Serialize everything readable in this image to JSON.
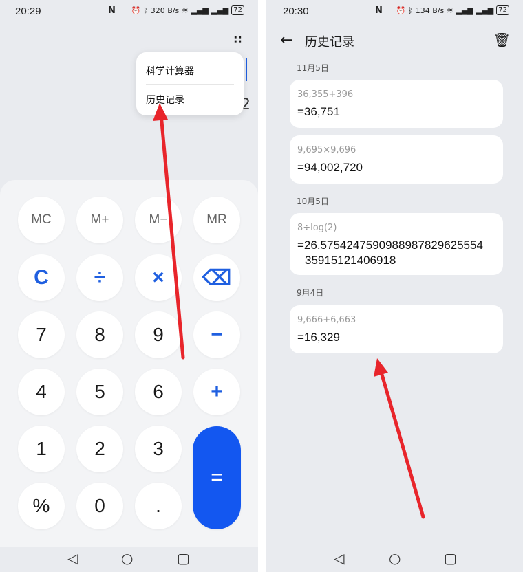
{
  "left": {
    "status": {
      "time": "20:29",
      "nfc": "N",
      "speed": "320 B/s",
      "battery": "72"
    },
    "menu": {
      "items": [
        "科学计算器",
        "历史记录"
      ]
    },
    "display_fragment": "2",
    "keys": [
      "MC",
      "M+",
      "M−",
      "MR",
      "C",
      "÷",
      "×",
      "⌫",
      "7",
      "8",
      "9",
      "−",
      "4",
      "5",
      "6",
      "+",
      "1",
      "2",
      "3",
      "=",
      "%",
      "0",
      "."
    ]
  },
  "right": {
    "status": {
      "time": "20:30",
      "nfc": "N",
      "speed": "134 B/s",
      "battery": "72"
    },
    "title": "历史记录",
    "groups": [
      {
        "date": "11月5日",
        "entries": [
          {
            "expr": "36,355+396",
            "result": "=36,751"
          },
          {
            "expr": "9,695×9,696",
            "result": "=94,002,720"
          }
        ]
      },
      {
        "date": "10月5日",
        "entries": [
          {
            "expr": "8÷log(2)",
            "result_line1": "=26.5754247590988987829625554",
            "result_line2": "35915121406918"
          }
        ]
      },
      {
        "date": "9月4日",
        "entries": [
          {
            "expr": "9,666+6,663",
            "result": "=16,329"
          }
        ]
      }
    ]
  },
  "colors": {
    "accent": "#1357f0",
    "arrow": "#e8252b",
    "background": "#e9ebef"
  },
  "icons": [
    "more-icon",
    "back-icon",
    "trash-icon",
    "backspace-icon",
    "nav-back-icon",
    "nav-home-icon",
    "nav-recents-icon"
  ]
}
